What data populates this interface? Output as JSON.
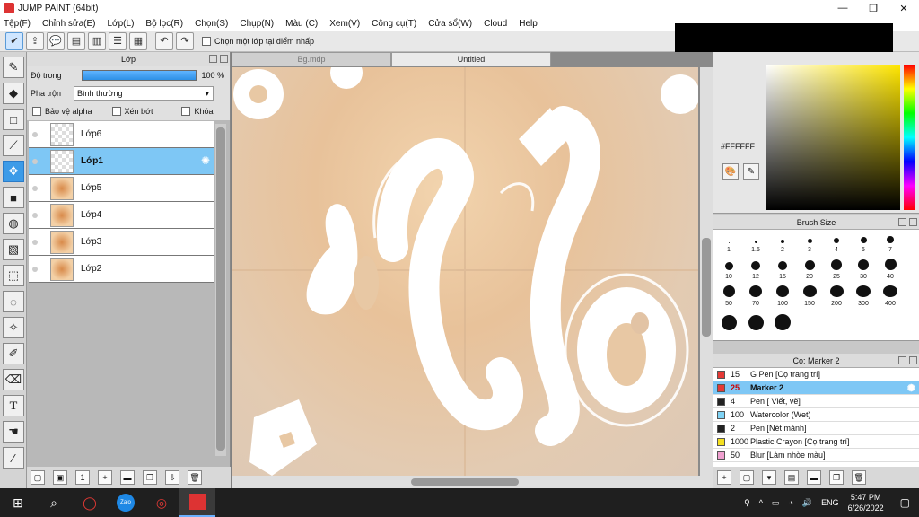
{
  "window": {
    "title": "JUMP PAINT (64bit)",
    "minimize": "—",
    "restore": "❐",
    "close": "✕"
  },
  "menu": [
    "Tệp(F)",
    "Chỉnh sửa(E)",
    "Lớp(L)",
    "Bộ lọc(R)",
    "Chọn(S)",
    "Chụp(N)",
    "Màu (C)",
    "Xem(V)",
    "Công cụ(T)",
    "Cửa sổ(W)",
    "Cloud",
    "Help"
  ],
  "toolbar": {
    "pick_layer_label": "Chọn một lớp tại điểm nhấp"
  },
  "layer_panel": {
    "title": "Lớp",
    "opacity_label": "Độ trong",
    "opacity_value": "100 %",
    "opacity_fraction": 1.0,
    "blend_label": "Pha trộn",
    "blend_value": "Bình thường",
    "protect_alpha": "Bảo vệ alpha",
    "clip": "Xén bớt",
    "lock": "Khóa",
    "layers": [
      {
        "name": "Lớp6",
        "selected": false,
        "thumb": "empty"
      },
      {
        "name": "Lớp1",
        "selected": true,
        "thumb": "empty"
      },
      {
        "name": "Lớp5",
        "selected": false,
        "thumb": "image"
      },
      {
        "name": "Lớp4",
        "selected": false,
        "thumb": "image"
      },
      {
        "name": "Lớp3",
        "selected": false,
        "thumb": "image"
      },
      {
        "name": "Lớp2",
        "selected": false,
        "thumb": "image"
      }
    ]
  },
  "document_tabs": [
    {
      "label": "Bg.mdp",
      "active": false
    },
    {
      "label": "Untitled",
      "active": true
    }
  ],
  "color_panel": {
    "hex": "#FFFFFF",
    "accent": "#ffe600"
  },
  "brush_size": {
    "title": "Brush Size",
    "sizes": [
      "1",
      "1.5",
      "2",
      "3",
      "4",
      "5",
      "7",
      "10",
      "12",
      "15",
      "20",
      "25",
      "30",
      "40",
      "50",
      "70",
      "100",
      "150",
      "200",
      "300",
      "400",
      "",
      "",
      ""
    ]
  },
  "tool_panel": {
    "title": "Cọ: Marker 2",
    "items": [
      {
        "size": "15",
        "name": "G Pen [Cọ trang trí]",
        "color": "#e53935",
        "selected": false
      },
      {
        "size": "25",
        "name": "Marker 2",
        "color": "#e53935",
        "selected": true
      },
      {
        "size": "4",
        "name": "Pen [ Viết, vẽ]",
        "color": "#222222",
        "selected": false
      },
      {
        "size": "100",
        "name": "Watercolor (Wet)",
        "color": "#7fd3f5",
        "selected": false
      },
      {
        "size": "2",
        "name": "Pen [Nét mảnh]",
        "color": "#222222",
        "selected": false
      },
      {
        "size": "1000",
        "name": "Plastic Crayon [Cọ trang trí]",
        "color": "#f5e020",
        "selected": false
      },
      {
        "size": "50",
        "name": "Blur [Làm nhòe màu]",
        "color": "#f0a0d0",
        "selected": false
      }
    ]
  },
  "taskbar": {
    "language": "ENG",
    "time": "5:47 PM",
    "date": "6/26/2022",
    "zalo": "Zalo"
  }
}
